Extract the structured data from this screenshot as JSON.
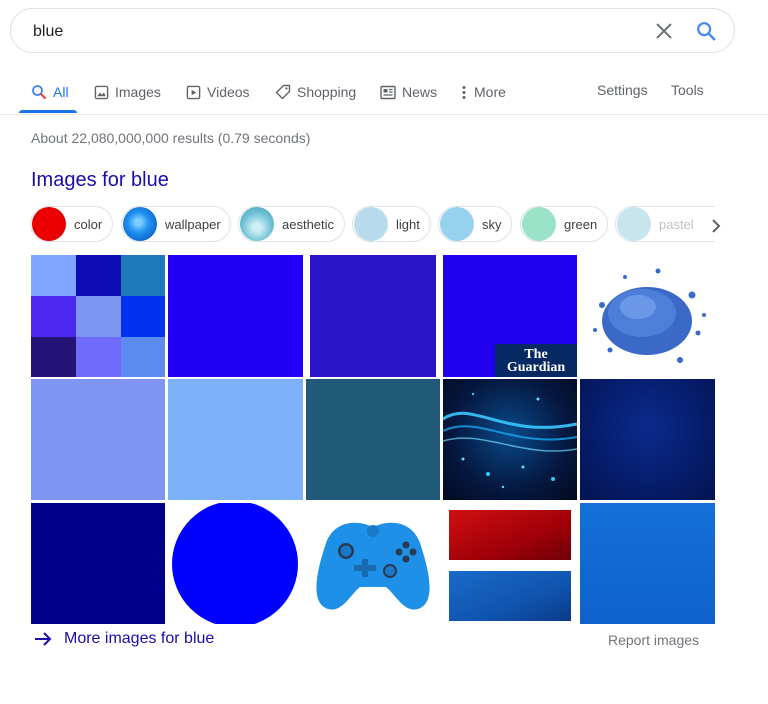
{
  "search": {
    "query": "blue"
  },
  "tabs": [
    {
      "label": "All",
      "icon": "search-icon"
    },
    {
      "label": "Images",
      "icon": "image-icon"
    },
    {
      "label": "Videos",
      "icon": "video-icon"
    },
    {
      "label": "Shopping",
      "icon": "tag-icon"
    },
    {
      "label": "News",
      "icon": "news-icon"
    },
    {
      "label": "More",
      "icon": "dots-vertical-icon"
    }
  ],
  "tools": {
    "settings": "Settings",
    "tools": "Tools"
  },
  "stats": "About 22,080,000,000 results (0.79 seconds)",
  "images_section": {
    "heading": "Images for blue",
    "chips": [
      "color",
      "wallpaper",
      "aesthetic",
      "light",
      "sky",
      "green",
      "pastel"
    ],
    "overlay_logo": "The Guardian",
    "more_link": "More images for blue",
    "report": "Report images"
  },
  "colors": {
    "link": "#1a0dab",
    "accent": "#1a73e8",
    "chip_color": "#dd0000",
    "chip_light": "#b8dcee",
    "chip_sky": "#96d2ef",
    "chip_green": "#9be3c8",
    "chip_pastel": "#c8e4ee"
  }
}
